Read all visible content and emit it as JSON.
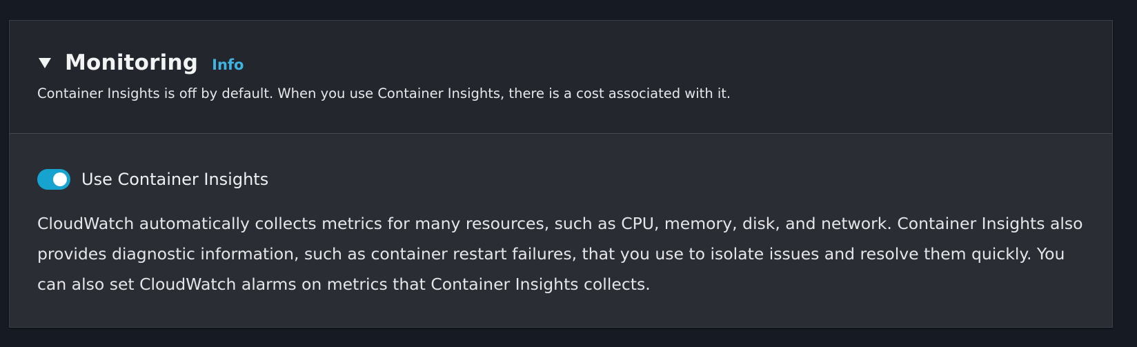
{
  "section": {
    "title": "Monitoring",
    "info_label": "Info",
    "description": "Container Insights is off by default. When you use Container Insights, there is a cost associated with it.",
    "expanded": true,
    "expand_icon": "caret-down-icon"
  },
  "container_insights": {
    "toggle_label": "Use Container Insights",
    "enabled": true,
    "description": "CloudWatch automatically collects metrics for many resources, such as CPU, memory, disk, and network. Container Insights also provides diagnostic information, such as container restart failures, that you use to isolate issues and resolve them quickly. You can also set CloudWatch alarms on metrics that Container Insights collects."
  },
  "colors": {
    "page_background": "#161a22",
    "panel_header": "#23262d",
    "panel_body": "#2a2d33",
    "accent": "#17a3cf",
    "info_link": "#3fb4e0",
    "text": "#e6e8ea"
  }
}
